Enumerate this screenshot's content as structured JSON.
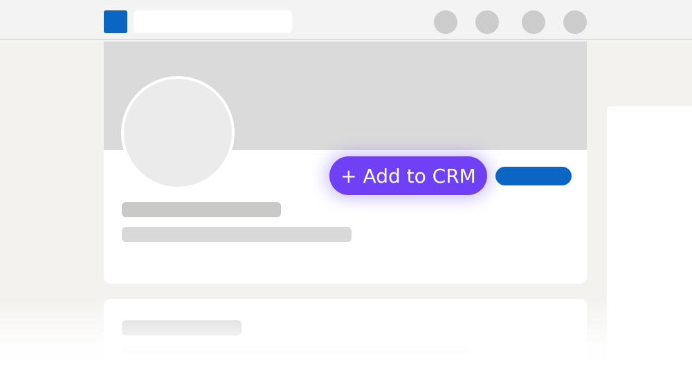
{
  "crm": {
    "add_label": "+ Add to CRM"
  },
  "colors": {
    "brand": "#0a66c2",
    "crm_accent": "#7040f7"
  },
  "icons": {
    "logo": "app-logo-icon",
    "nav": [
      "nav-icon",
      "nav-icon",
      "nav-icon",
      "nav-icon"
    ]
  }
}
